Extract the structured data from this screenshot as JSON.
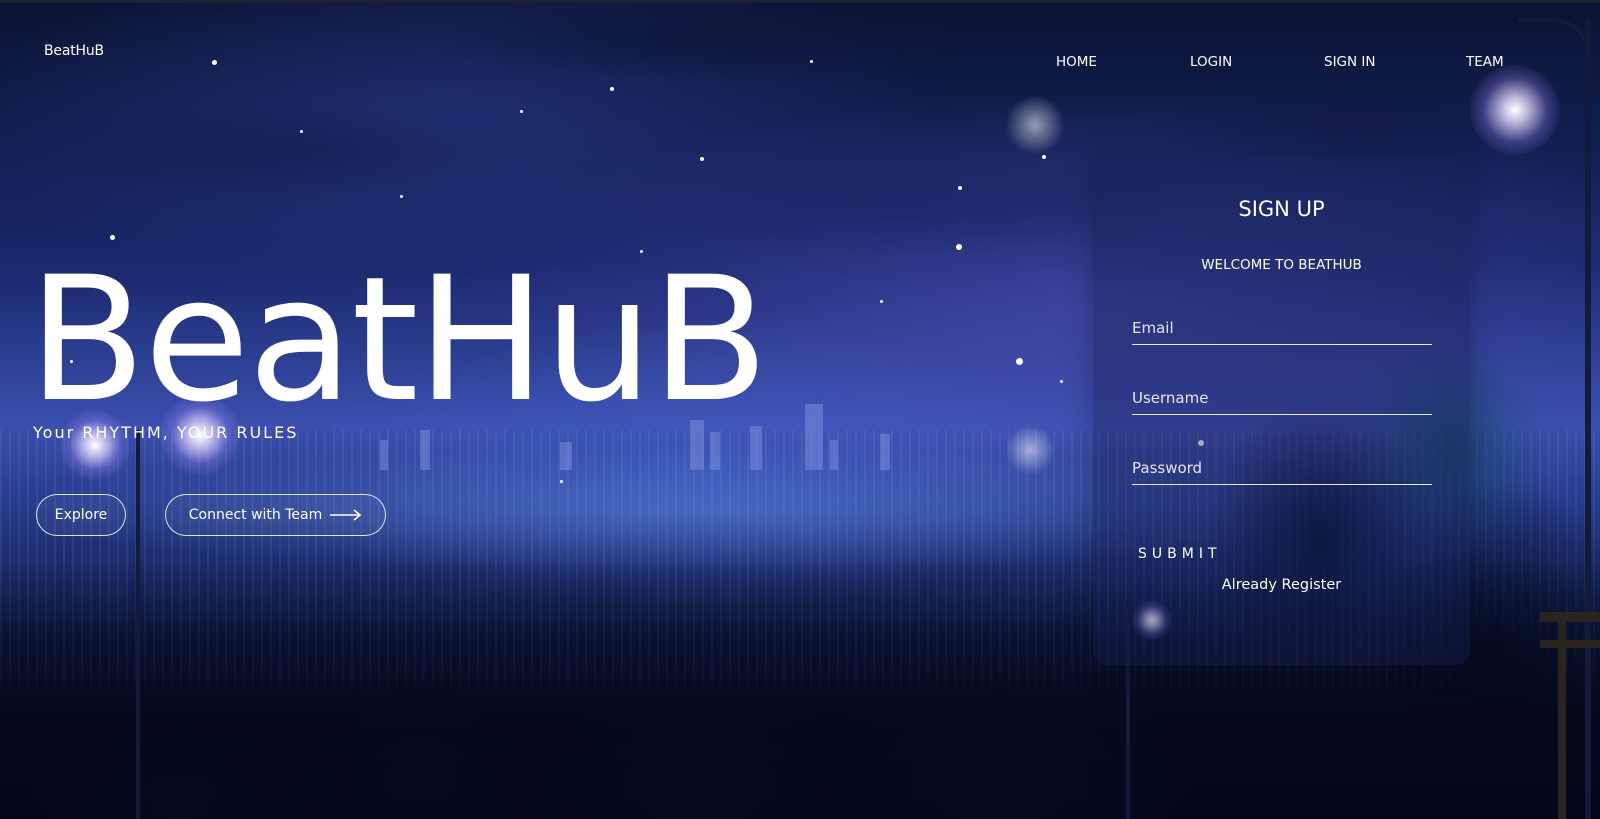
{
  "header": {
    "brand": "BeatHuB",
    "nav": [
      {
        "label": "HOME"
      },
      {
        "label": "LOGIN"
      },
      {
        "label": "SIGN IN"
      },
      {
        "label": "TEAM"
      }
    ]
  },
  "hero": {
    "title": "BeatHuB",
    "tagline": "Your RHYTHM, YOUR RULES",
    "buttons": {
      "explore": "Explore",
      "connect": "Connect with Team"
    }
  },
  "signup": {
    "title": "SIGN UP",
    "subtitle": "WELCOME TO BEATHUB",
    "fields": {
      "email_placeholder": "Email",
      "username_placeholder": "Username",
      "password_placeholder": "Password"
    },
    "submit_label": "SUBMIT",
    "already_register": "Already Register"
  },
  "icons": {
    "connect_arrow": "arrow-right-icon"
  },
  "colors": {
    "text": "#ffffff",
    "sky_top": "#0b1333",
    "sky_mid": "#3b4fae",
    "panel_bg": "rgba(20,28,80,0.38)"
  }
}
